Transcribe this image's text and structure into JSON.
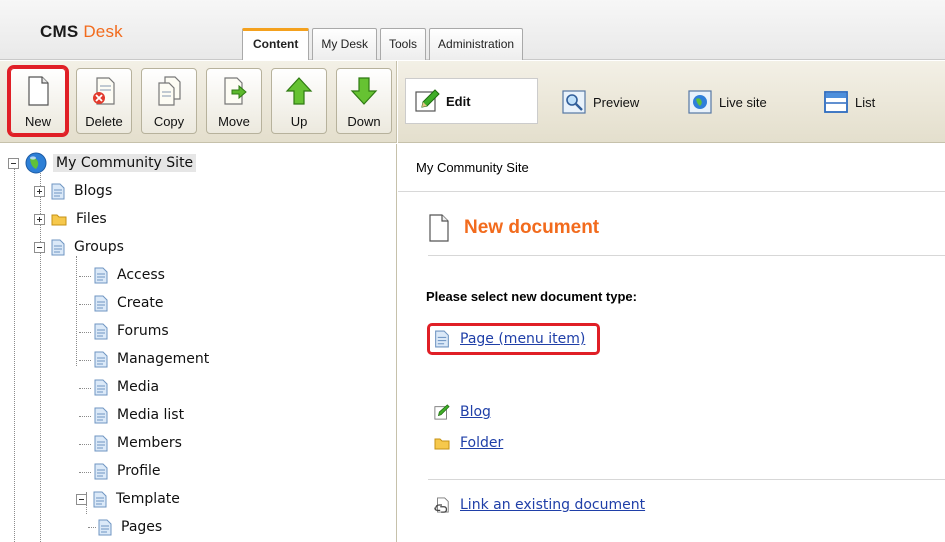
{
  "app": {
    "brand_cms": "CMS",
    "brand_desk": "Desk"
  },
  "tabs": [
    {
      "label": "Content",
      "active": true
    },
    {
      "label": "My Desk",
      "active": false
    },
    {
      "label": "Tools",
      "active": false
    },
    {
      "label": "Administration",
      "active": false
    }
  ],
  "toolbar": {
    "new_label": "New",
    "delete_label": "Delete",
    "copy_label": "Copy",
    "move_label": "Move",
    "up_label": "Up",
    "down_label": "Down"
  },
  "view_modes": {
    "edit_label": "Edit",
    "preview_label": "Preview",
    "live_label": "Live site",
    "list_label": "List"
  },
  "tree": {
    "root": "My Community Site",
    "items": [
      {
        "label": "Blogs"
      },
      {
        "label": "Files"
      },
      {
        "label": "Groups"
      },
      {
        "label": "Access"
      },
      {
        "label": "Create"
      },
      {
        "label": "Forums"
      },
      {
        "label": "Management"
      },
      {
        "label": "Media"
      },
      {
        "label": "Media list"
      },
      {
        "label": "Members"
      },
      {
        "label": "Profile"
      },
      {
        "label": "Template"
      },
      {
        "label": "Pages"
      }
    ]
  },
  "main": {
    "breadcrumb": "My Community Site",
    "title": "New document",
    "select_prompt": "Please select new document type:",
    "doc_types": {
      "page": "Page (menu item)",
      "blog": "Blog",
      "folder": "Folder"
    },
    "link_existing": "Link an existing document"
  },
  "colors": {
    "accent_orange": "#f26b1d",
    "highlight_red": "#e01f26",
    "link_blue": "#1f3fa8"
  }
}
